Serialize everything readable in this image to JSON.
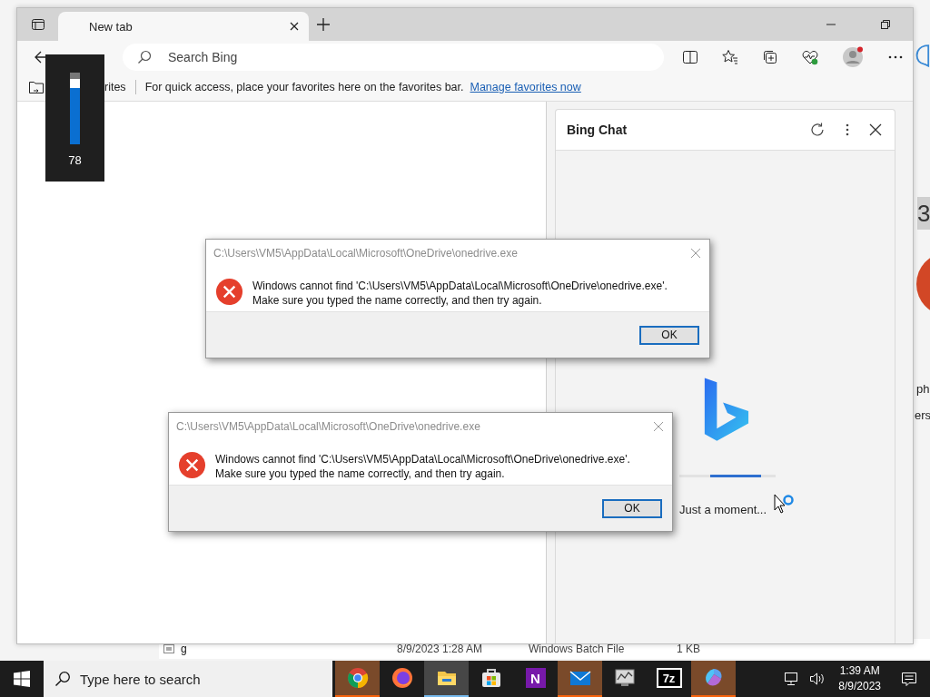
{
  "background": {
    "file_row": [
      "g",
      "8/9/2023 1:28 AM",
      "Windows Batch File",
      "1 KB"
    ],
    "edge_fragments": [
      "3",
      "ph",
      "ers"
    ]
  },
  "browser": {
    "tabs": [
      {
        "title": "New tab",
        "selected": true
      }
    ],
    "search": {
      "placeholder": "Search Bing"
    },
    "favorites_bar": {
      "label": "rites",
      "hint": "For quick access, place your favorites here on the favorites bar.",
      "link": "Manage favorites now"
    },
    "side_panel": {
      "title": "Bing Chat",
      "status": "Just a moment..."
    }
  },
  "volume_flyout": {
    "level": 0.78,
    "reading": "78"
  },
  "dialogs": [
    {
      "title": "C:\\Users\\VM5\\AppData\\Local\\Microsoft\\OneDrive\\onedrive.exe",
      "message": [
        "Windows cannot find 'C:\\Users\\VM5\\AppData\\Local\\Microsoft\\OneDrive\\onedrive.exe'.",
        "Make sure you typed the name correctly, and then try again."
      ],
      "button": "OK"
    },
    {
      "title": "C:\\Users\\VM5\\AppData\\Local\\Microsoft\\OneDrive\\onedrive.exe",
      "message": [
        "Windows cannot find 'C:\\Users\\VM5\\AppData\\Local\\Microsoft\\OneDrive\\onedrive.exe'.",
        "Make sure you typed the name correctly, and then try again."
      ],
      "button": "OK"
    }
  ],
  "taskbar": {
    "search_placeholder": "Type here to search",
    "apps": [
      {
        "kind": "chrome",
        "flashing": true,
        "active": false
      },
      {
        "kind": "firefox",
        "flashing": false,
        "active": false
      },
      {
        "kind": "explorer",
        "flashing": false,
        "active": true
      },
      {
        "kind": "store",
        "flashing": false,
        "active": false
      },
      {
        "kind": "onenote",
        "label": "N",
        "flashing": false,
        "active": false
      },
      {
        "kind": "mail",
        "flashing": true,
        "active": false
      },
      {
        "kind": "monitor",
        "flashing": false,
        "active": false
      },
      {
        "kind": "archiver",
        "label": "7z",
        "flashing": false,
        "active": false
      },
      {
        "kind": "assistant",
        "flashing": true,
        "active": false
      }
    ],
    "time": "1:39 AM",
    "date": "8/9/2023"
  }
}
